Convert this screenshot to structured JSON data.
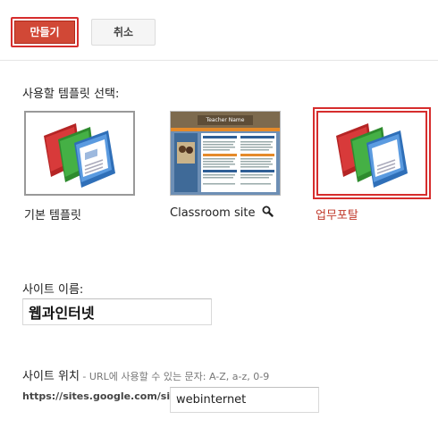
{
  "toolbar": {
    "create_label": "만들기",
    "cancel_label": "취소"
  },
  "template_section": {
    "label": "사용할 템플릿 선택:",
    "templates": [
      {
        "caption": "기본 템플릿",
        "selected": false,
        "icon": "sites-template-icon"
      },
      {
        "caption": "Classroom site",
        "selected": false,
        "icon": "classroom-preview-thumbnail",
        "preview_title": "Teacher Name",
        "has_magnifier": true
      },
      {
        "caption": "업무포탈",
        "selected": true,
        "icon": "sites-template-icon"
      }
    ]
  },
  "site_name": {
    "label": "사이트 이름:",
    "value": "웹과인터넷"
  },
  "site_location": {
    "label": "사이트 위치",
    "separator": " - ",
    "hint": "URL에 사용할 수 있는 문자: A-Z, a-z, 0-9",
    "url_prefix": "https://sites.google.com/site/",
    "value": "webinternet"
  },
  "colors": {
    "accent_red": "#d14836",
    "selected_border": "#d62d2d",
    "selected_caption": "#c0392b"
  }
}
